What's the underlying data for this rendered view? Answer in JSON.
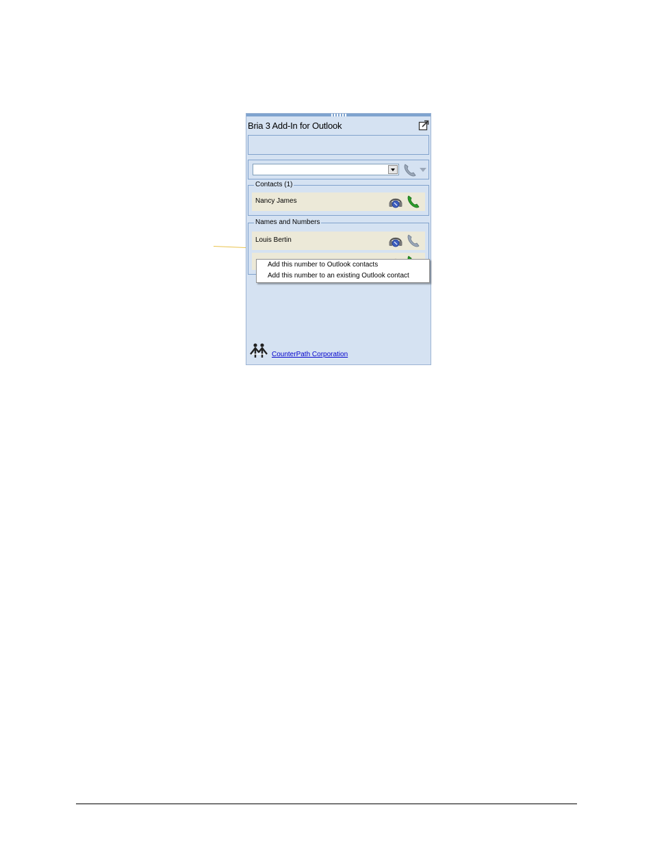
{
  "panel": {
    "title": "Bria 3 Add-In for Outlook",
    "info_text": "",
    "dial_value": ""
  },
  "contacts_group": {
    "label": "Contacts (1)",
    "items": [
      {
        "name": "Nancy James",
        "call_icon": "phone-green-icon"
      }
    ]
  },
  "names_group": {
    "label": "Names and Numbers",
    "items": [
      {
        "name": "Louis Bertin",
        "call_icon": "phone-gray-icon"
      },
      {
        "name": "",
        "call_icon": "phone-green-icon"
      }
    ]
  },
  "context_menu": {
    "items": [
      "Add this number to Outlook contacts",
      "Add this number to an existing Outlook contact"
    ]
  },
  "footer": {
    "link_text": "CounterPath Corporation"
  },
  "colors": {
    "panel_bg": "#d5e2f2",
    "panel_border": "#7fa1cc",
    "row_bg": "#ece9d8",
    "link": "#0000cc",
    "call_green": "#2a9d2a",
    "callout": "#e9c24b"
  }
}
